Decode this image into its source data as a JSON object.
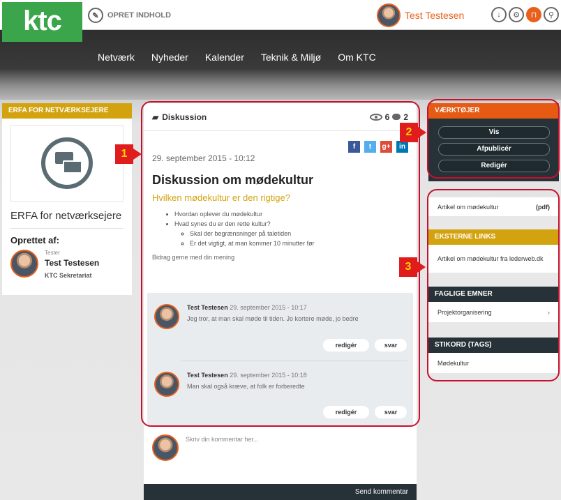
{
  "brand": {
    "logo": "ktc",
    "accent": "#e8601c",
    "green": "#3aa54a",
    "gold": "#d3a30f",
    "dark": "#273238"
  },
  "topbar": {
    "create_label": "OPRET INDHOLD",
    "user_name": "Test Testesen"
  },
  "nav": [
    "Netværk",
    "Nyheder",
    "Kalender",
    "Teknik & Miljø",
    "Om KTC"
  ],
  "left": {
    "panel_title": "ERFA FOR NETVÆRKSEJERE",
    "group_title": "ERFA for netværksejere",
    "created_by_label": "Oprettet af:",
    "creator_role": "Tester",
    "creator_name": "Test Testesen",
    "creator_org": "KTC Sekretariat"
  },
  "discussion": {
    "type_label": "Diskussion",
    "views": "6",
    "comment_count": "2",
    "date": "29. september 2015 - 10:12",
    "title": "Diskussion om mødekultur",
    "subtitle": "Hvilken mødekultur er den rigtige?",
    "bullets": [
      "Hvordan oplever du mødekultur",
      "Hvad synes du er den rette kultur?"
    ],
    "sub_bullets": [
      "Skal der begrænsninger på taletiden",
      "Er det vigtigt, at man kommer 10 minutter før"
    ],
    "contribute_text": "Bidrag gerne med din mening",
    "share": {
      "facebook": "f",
      "twitter": "t",
      "googleplus": "g+",
      "linkedin": "in"
    }
  },
  "comments": [
    {
      "author": "Test Testesen",
      "date": "29. september 2015 - 10:17",
      "text": "Jeg tror, at man skal møde til tiden. Jo kortere møde, jo bedre",
      "edit_label": "redigér",
      "reply_label": "svar"
    },
    {
      "author": "Test Testesen",
      "date": "29. september 2015 - 10:18",
      "text": "Man skal også kræve, at folk er forberedte",
      "edit_label": "redigér",
      "reply_label": "svar"
    }
  ],
  "write": {
    "placeholder": "Skriv din kommentar her...",
    "send_label": "Send kommentar"
  },
  "right": {
    "tools_title": "VÆRKTØJER",
    "tools_buttons": [
      "Vis",
      "Afpublicér",
      "Redigér"
    ],
    "article": {
      "label": "Artikel om mødekultur",
      "type": "(pdf)"
    },
    "external_title": "EKSTERNE LINKS",
    "external_link": "Artikel om mødekultur fra lederweb.dk",
    "subjects_title": "FAGLIGE EMNER",
    "subject_item": "Projektorganisering",
    "tags_title": "STIKORD (TAGS)",
    "tag_item": "Mødekultur"
  },
  "annotations": [
    "1",
    "2",
    "3"
  ]
}
